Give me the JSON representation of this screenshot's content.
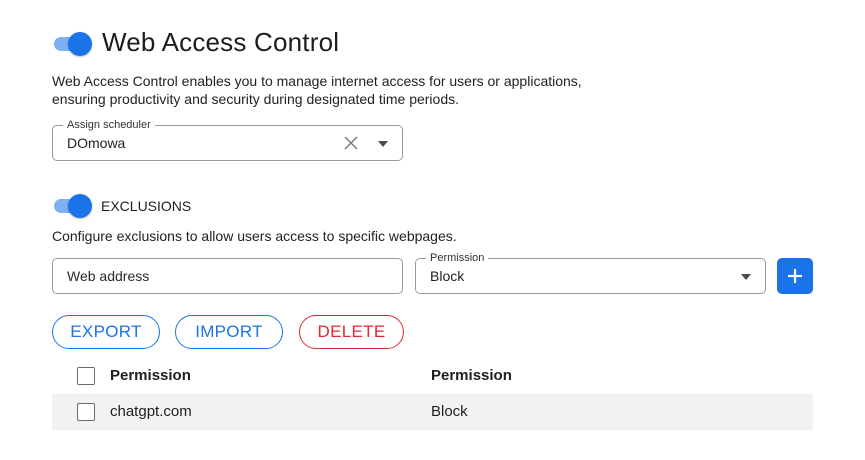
{
  "header": {
    "title": "Web Access Control",
    "enabled": true,
    "description_line1": "Web Access Control enables you to manage internet access for users or applications,",
    "description_line2": "ensuring productivity and security during designated time periods."
  },
  "scheduler": {
    "label": "Assign scheduler",
    "value": "DOmowa"
  },
  "exclusions": {
    "label": "EXCLUSIONS",
    "enabled": true,
    "description": "Configure exclusions to allow users access to specific webpages.",
    "address_placeholder": "Web address",
    "permission_label": "Permission",
    "permission_value": "Block"
  },
  "actions": {
    "export": "EXPORT",
    "import": "IMPORT",
    "delete": "DELETE"
  },
  "table": {
    "columns": [
      "Permission",
      "Permission"
    ],
    "rows": [
      {
        "address": "chatgpt.com",
        "permission": "Block"
      }
    ]
  },
  "colors": {
    "accent": "#1a73e8",
    "toggle_track": "#7fb0f2",
    "danger": "#e0282e",
    "row_background": "#f2f2f2"
  },
  "icons": {
    "clear": "close-icon",
    "dropdown": "chevron-down-icon",
    "add": "plus-icon"
  }
}
